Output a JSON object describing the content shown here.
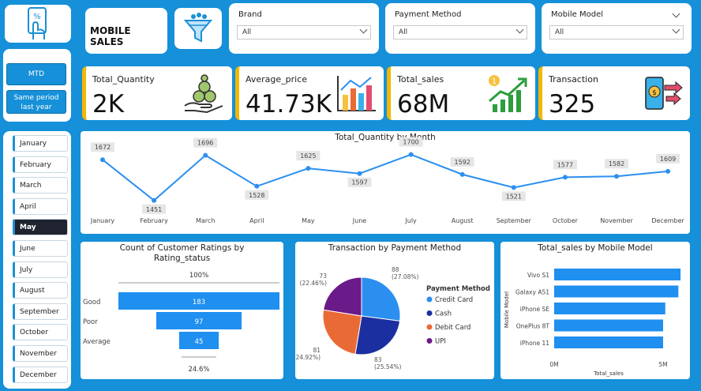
{
  "title": "MOBILE SALES",
  "slicers": {
    "brand": {
      "label": "Brand",
      "value": "All"
    },
    "payment": {
      "label": "Payment Method",
      "value": "All"
    },
    "model": {
      "label": "Mobile Model",
      "value": "All"
    }
  },
  "buttons": {
    "mtd": "MTD",
    "spl": "Same period last year"
  },
  "months": [
    "January",
    "February",
    "March",
    "April",
    "May",
    "June",
    "July",
    "August",
    "September",
    "October",
    "November",
    "December"
  ],
  "selected_month": "May",
  "kpis": {
    "quantity": {
      "label": "Total_Quantity",
      "value": "2K"
    },
    "price": {
      "label": "Average_price",
      "value": "41.73K"
    },
    "sales": {
      "label": "Total_sales",
      "value": "68M",
      "badge": "1"
    },
    "transaction": {
      "label": "Transaction",
      "value": "325"
    }
  },
  "icons": [
    "phone-percent-icon",
    "filter-funnel-icon",
    "money-bags-icon",
    "bar-chart-icon",
    "growth-arrow-icon",
    "phone-payment-icon"
  ],
  "colors": {
    "accent": "#1590d9",
    "kpi_border": "#f2b700",
    "series": "#2b8ff0"
  },
  "chart_data": [
    {
      "type": "line",
      "title": "Total_Quantity by Month",
      "x": [
        "January",
        "February",
        "March",
        "April",
        "May",
        "June",
        "July",
        "August",
        "September",
        "October",
        "November",
        "December"
      ],
      "series": [
        {
          "values": [
            1672,
            1451,
            1696,
            1528,
            1625,
            1597,
            1700,
            1592,
            1521,
            1577,
            1582,
            1609
          ]
        }
      ]
    },
    {
      "type": "bar",
      "title": "Count of Customer Ratings by Rating_status",
      "categories": [
        "Good",
        "Poor",
        "Average"
      ],
      "values": [
        183,
        97,
        45
      ],
      "top_label": "100%",
      "bottom_label": "24.6%"
    },
    {
      "type": "pie",
      "title": "Transaction by Payment Method",
      "legend_title": "Payment Method",
      "categories": [
        "Credit Card",
        "Cash",
        "Debit Card",
        "UPI"
      ],
      "values": [
        88,
        83,
        81,
        73
      ],
      "percents": [
        "(27.08%)",
        "(25.54%)",
        "(24.92%)",
        "(22.46%)"
      ],
      "colors": [
        "#2b8ff0",
        "#1c2fa0",
        "#ea6a36",
        "#6b1a8a"
      ]
    },
    {
      "type": "bar",
      "title": "Total_sales by Mobile Model",
      "categories": [
        "Vivo S1",
        "Galaxy A51",
        "iPhone SE",
        "OnePlus 8T",
        "iPhone 11"
      ],
      "values": [
        5.8,
        5.7,
        5.1,
        5.0,
        5.0
      ],
      "xlabel": "Total_sales",
      "ylabel": "Mobile Model",
      "xticks": [
        "0M",
        "5M"
      ]
    }
  ]
}
